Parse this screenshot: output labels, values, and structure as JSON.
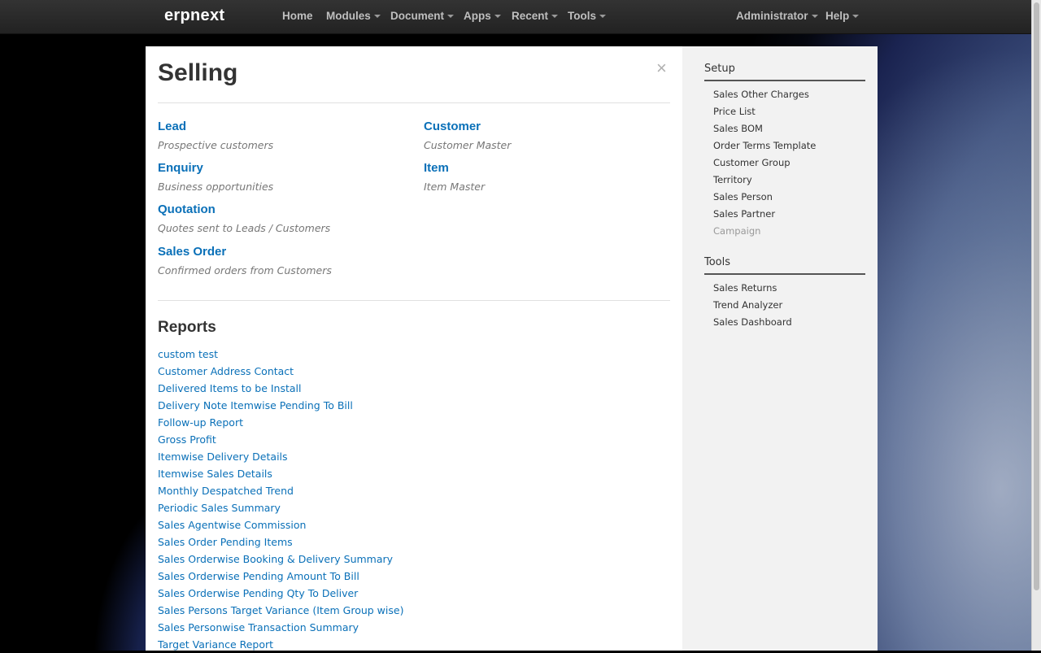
{
  "navbar": {
    "brand": "erpnext",
    "items": [
      {
        "label": "Home",
        "dropdown": false
      },
      {
        "label": "Modules",
        "dropdown": true
      },
      {
        "label": "Document",
        "dropdown": true
      },
      {
        "label": "Apps",
        "dropdown": true
      },
      {
        "label": "Recent",
        "dropdown": true
      },
      {
        "label": "Tools",
        "dropdown": true
      }
    ],
    "right_items": [
      {
        "label": "Administrator",
        "dropdown": true
      },
      {
        "label": "Help",
        "dropdown": true
      }
    ]
  },
  "page": {
    "title": "Selling",
    "close_glyph": "×",
    "documents": [
      {
        "label": "Lead",
        "description": "Prospective customers"
      },
      {
        "label": "Enquiry",
        "description": "Business opportunities"
      },
      {
        "label": "Quotation",
        "description": "Quotes sent to Leads / Customers"
      },
      {
        "label": "Sales Order",
        "description": "Confirmed orders from Customers"
      },
      {
        "label": "Customer",
        "description": "Customer Master"
      },
      {
        "label": "Item",
        "description": "Item Master"
      }
    ],
    "reports_title": "Reports",
    "reports": [
      "custom test",
      "Customer Address Contact",
      "Delivered Items to be Install",
      "Delivery Note Itemwise Pending To Bill",
      "Follow-up Report",
      "Gross Profit",
      "Itemwise Delivery Details",
      "Itemwise Sales Details",
      "Monthly Despatched Trend",
      "Periodic Sales Summary",
      "Sales Agentwise Commission",
      "Sales Order Pending Items",
      "Sales Orderwise Booking & Delivery Summary",
      "Sales Orderwise Pending Amount To Bill",
      "Sales Orderwise Pending Qty To Deliver",
      "Sales Persons Target Variance (Item Group wise)",
      "Sales Personwise Transaction Summary",
      "Target Variance Report"
    ]
  },
  "sidebar": {
    "setup_heading": "Setup",
    "setup_items": [
      {
        "label": "Sales Other Charges",
        "disabled": false
      },
      {
        "label": "Price List",
        "disabled": false
      },
      {
        "label": "Sales BOM",
        "disabled": false
      },
      {
        "label": "Order Terms Template",
        "disabled": false
      },
      {
        "label": "Customer Group",
        "disabled": false
      },
      {
        "label": "Territory",
        "disabled": false
      },
      {
        "label": "Sales Person",
        "disabled": false
      },
      {
        "label": "Sales Partner",
        "disabled": false
      },
      {
        "label": "Campaign",
        "disabled": true
      }
    ],
    "tools_heading": "Tools",
    "tools_items": [
      {
        "label": "Sales Returns"
      },
      {
        "label": "Trend Analyzer"
      },
      {
        "label": "Sales Dashboard"
      }
    ]
  },
  "colors": {
    "link": "#0a70b8",
    "navbar_bg": "#222222",
    "sidebar_bg": "#f2f2f2"
  }
}
